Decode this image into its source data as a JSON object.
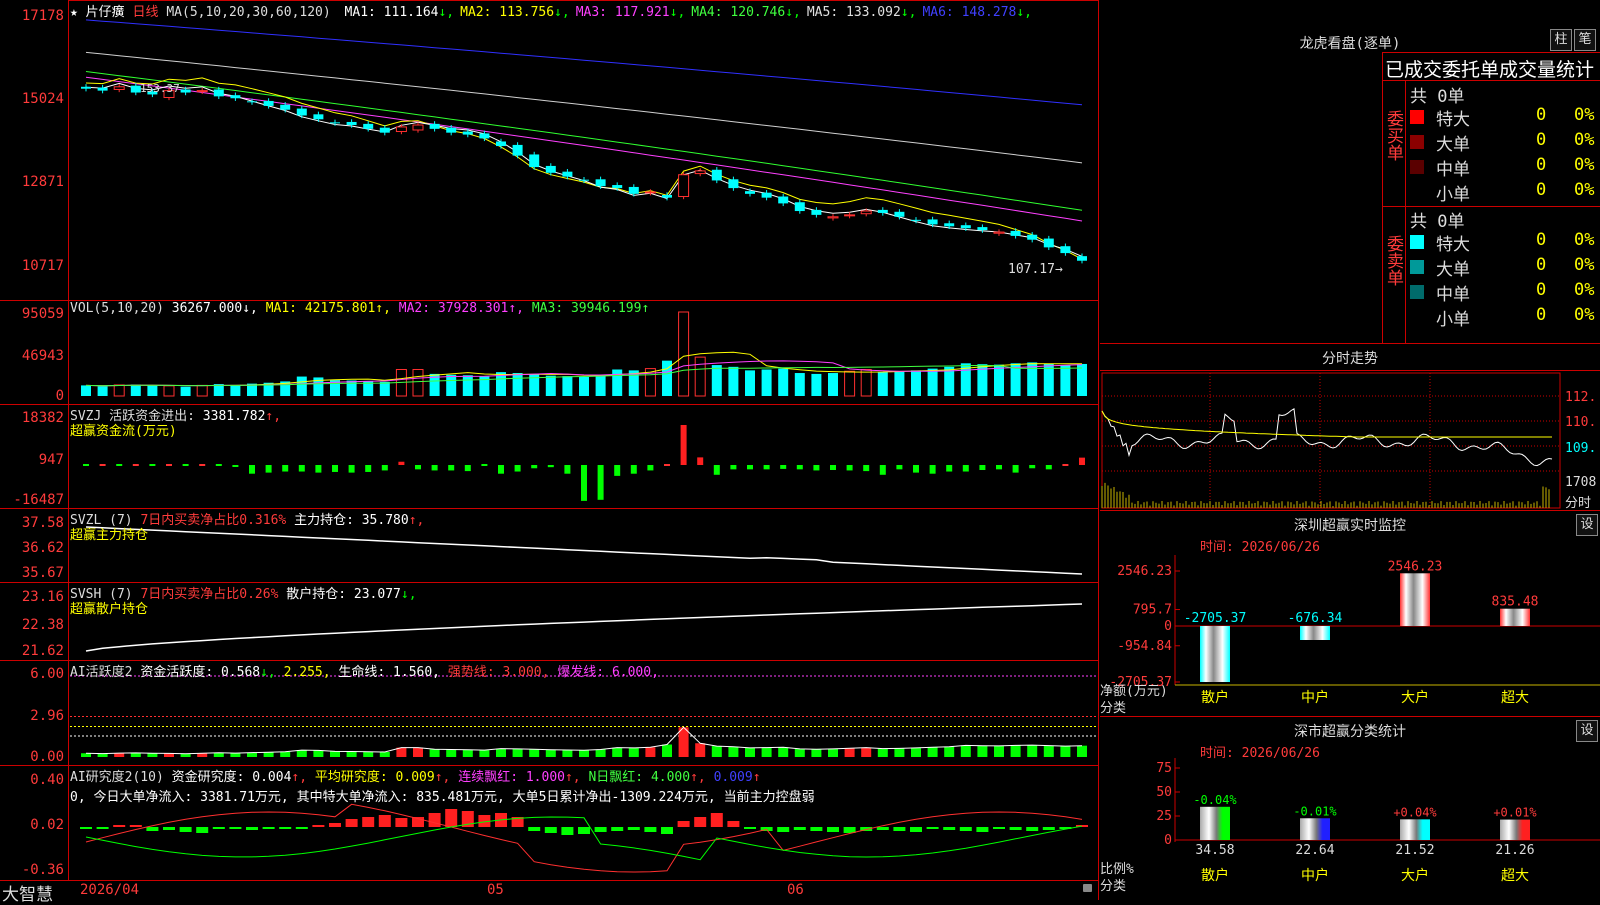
{
  "main": {
    "stock_name": "片仔癀",
    "period": "日线",
    "ma_header": "MA(5,10,20,30,60,120)",
    "ma_values": [
      {
        "label": "MA1:",
        "value": "111.164",
        "arrow": "↓",
        "color": "#ffffff"
      },
      {
        "label": "MA2:",
        "value": "113.756",
        "arrow": "↓",
        "color": "#ffff00"
      },
      {
        "label": "MA3:",
        "value": "117.921",
        "arrow": "↓",
        "color": "#ff40ff"
      },
      {
        "label": "MA4:",
        "value": "120.746",
        "arrow": "↓",
        "color": "#40ff40"
      },
      {
        "label": "MA5:",
        "value": "133.092",
        "arrow": "↓",
        "color": "#e0e0e0"
      },
      {
        "label": "MA6:",
        "value": "148.278",
        "arrow": "↓",
        "color": "#4040ff"
      }
    ],
    "y_ticks": [
      "17178",
      "15024",
      "12871",
      "10717"
    ],
    "hi_label": "153.37",
    "lo_label": "107.17→"
  },
  "vol": {
    "header": "VOL(5,10,20)",
    "value": "36267.000",
    "ma1": "42175.801",
    "ma2": "37928.301",
    "ma3": "39946.199",
    "y_ticks": [
      "95059",
      "46943",
      "0"
    ]
  },
  "svzj": {
    "header": "SVZJ  活跃资金进出:",
    "value": "3381.782",
    "sub": "超赢资金流(万元)",
    "y_ticks": [
      "18382",
      "947",
      "-16487"
    ]
  },
  "svzl": {
    "header": "SVZL (7)",
    "desc": "7日内买卖净占比0.316%",
    "hold_label": "主力持仓:",
    "hold_value": "35.780",
    "sub": "超赢主力持仓",
    "y_ticks": [
      "37.58",
      "36.62",
      "35.67"
    ]
  },
  "svsh": {
    "header": "SVSH (7)",
    "desc": "7日内买卖净占比0.26%",
    "hold_label": "散户持仓:",
    "hold_value": "23.077",
    "sub": "超赢散户持仓",
    "y_ticks": [
      "23.16",
      "22.38",
      "21.62"
    ]
  },
  "ai_active": {
    "header": "AI活跃度2",
    "label": "资金活跃度:",
    "v1": "0.568",
    "v2": "2.255",
    "life": "生命线: 1.560,",
    "strong": "强势线: 3.000,",
    "burst": "爆发线: 6.000,",
    "y_ticks": [
      "6.00",
      "2.96",
      "0.00"
    ]
  },
  "ai_research": {
    "header": "AI研究度2(10)",
    "label": "资金研究度:",
    "v1": "0.004",
    "avg": "平均研究度: 0.009",
    "red": "连续飘红: 1.000",
    "nday": "N日飘红: 4.000",
    "last": "0.009",
    "summary": "0, 今日大单净流入: 3381.71万元, 其中特大单净流入: 835.481万元, 大单5日累计净出-1309.224万元, 当前主力控盘弱",
    "y_ticks": [
      "0.40",
      "0.02",
      "-0.36"
    ]
  },
  "xaxis": {
    "brand": "大智慧",
    "start_date": "2026/04",
    "m05": "05",
    "m06": "06"
  },
  "right": {
    "dragon_title": "龙虎看盘(逐单)",
    "btn_column": "柱",
    "btn_pen": "笔",
    "stats_title": "已成交委托单成交量统计",
    "buy_side": "委买单",
    "sell_side": "委卖单",
    "buy_total": "共 0单",
    "sell_total": "共 0单",
    "buy_rows": [
      {
        "name": "特大",
        "count": "0",
        "pct": "0%",
        "color": "#ff0000"
      },
      {
        "name": "大单",
        "count": "0",
        "pct": "0%",
        "color": "#8b0000"
      },
      {
        "name": "中单",
        "count": "0",
        "pct": "0%",
        "color": "#5a0000"
      },
      {
        "name": "小单",
        "count": "0",
        "pct": "0%",
        "color": ""
      }
    ],
    "sell_rows": [
      {
        "name": "特大",
        "count": "0",
        "pct": "0%",
        "color": "#00ffff"
      },
      {
        "name": "大单",
        "count": "0",
        "pct": "0%",
        "color": "#009999"
      },
      {
        "name": "中单",
        "count": "0",
        "pct": "0%",
        "color": "#006b6b"
      },
      {
        "name": "小单",
        "count": "0",
        "pct": "0%",
        "color": ""
      }
    ],
    "intraday_title": "分时走势",
    "intraday_ticks": [
      "112.",
      "110.",
      "109.",
      "1708",
      "分时"
    ],
    "monitor_title": "深圳超赢实时监控",
    "monitor_date": "时间: 2026/06/26",
    "monitor_btn": "设",
    "monitor_yticks": [
      "2546.23",
      "795.7",
      "0",
      "-954.84",
      "-2705.37"
    ],
    "monitor_ylabel": "净额(万元)",
    "monitor_xlabel": "分类",
    "monitor_bars": [
      {
        "name": "散户",
        "value": 2705.37,
        "label": "-2705.37",
        "sign": "neg",
        "label_color": "#00ffff"
      },
      {
        "name": "中户",
        "value": 676.34,
        "label": "-676.34",
        "sign": "neg",
        "label_color": "#00ffff"
      },
      {
        "name": "大户",
        "value": 2546.23,
        "label": "2546.23",
        "sign": "pos",
        "label_color": "#ff3b3b"
      },
      {
        "name": "超大",
        "value": 835.48,
        "label": "835.48",
        "sign": "pos",
        "label_color": "#ff3b3b"
      }
    ],
    "class_title": "深市超赢分类统计",
    "class_date": "时间: 2026/06/26",
    "class_btn": "设",
    "class_yticks": [
      "75",
      "50",
      "25",
      "0"
    ],
    "class_ylabel": "比例%",
    "class_xlabel": "分类",
    "class_bars": [
      {
        "name": "散户",
        "value": 34.58,
        "label": "34.58",
        "change": "-0.04%",
        "change_color": "#00ff00",
        "color": "#00ff00"
      },
      {
        "name": "中户",
        "value": 22.64,
        "label": "22.64",
        "change": "-0.01%",
        "change_color": "#00ff00",
        "color": "#2020ff"
      },
      {
        "name": "大户",
        "value": 21.52,
        "label": "21.52",
        "change": "+0.04%",
        "change_color": "#ff3b3b",
        "color": "#00ffff"
      },
      {
        "name": "超大",
        "value": 21.26,
        "label": "21.26",
        "change": "+0.01%",
        "change_color": "#ff3b3b",
        "color": "#ff2020"
      }
    ]
  }
}
